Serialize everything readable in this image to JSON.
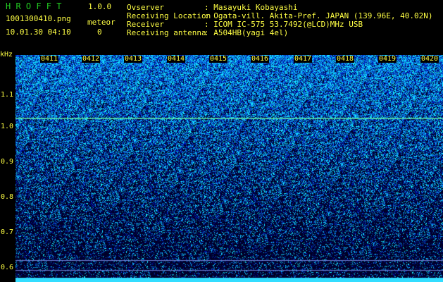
{
  "header": {
    "app_title": "H R O F F T",
    "version": "1.0.0",
    "filename": "1001300410.png",
    "datetime": "10.01.30 04:10",
    "meteor_label": "meteor",
    "meteor_count": "0"
  },
  "info": [
    {
      "label": "Ovserver",
      "value": ": Masayuki Kobayashi"
    },
    {
      "label": "Receiving Location",
      "value": ": Ogata-vill. Akita-Pref. JAPAN (139.96E, 40.02N)"
    },
    {
      "label": "Receiver",
      "value": ": ICOM IC-575 53.7492(@LCD)MHz USB"
    },
    {
      "label": "Receiving antenna",
      "value": ": A504HB(yagi 4el)"
    }
  ],
  "y_axis": {
    "unit": "kHz",
    "ticks": [
      "1.1",
      "1.0",
      "0.9",
      "0.8",
      "0.7",
      "0.6"
    ]
  },
  "time_labels": [
    "0411",
    "0412",
    "0413",
    "0414",
    "0415",
    "0416",
    "0417",
    "0418",
    "0419",
    "0420"
  ],
  "colors": {
    "header_green": "#22cc22",
    "label_yellow": "#ffff44",
    "carrier_line": "#66ffaa"
  }
}
